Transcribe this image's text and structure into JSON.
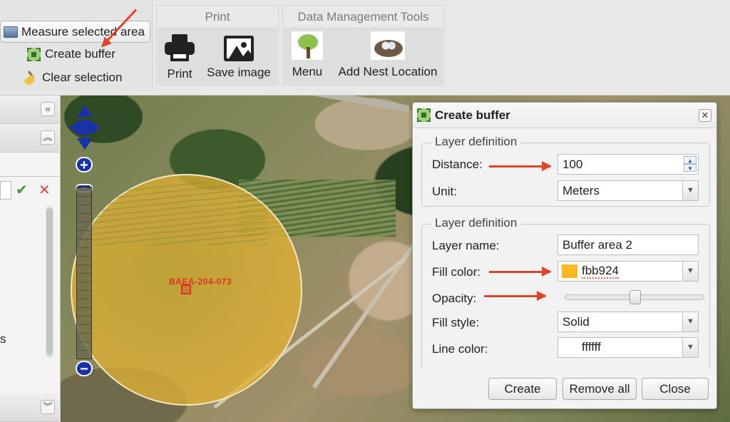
{
  "toolbar": {
    "measure_label": "Measure selected area",
    "create_buffer_label": "Create buffer",
    "clear_selection_label": "Clear selection",
    "print_group": {
      "title": "Print",
      "print_label": "Print",
      "save_image_label": "Save image"
    },
    "data_group": {
      "title": "Data Management Tools",
      "menu_label": "Menu",
      "add_nest_label": "Add Nest Location"
    }
  },
  "left_panel": {
    "collapse_symbol": "«",
    "expand_up_symbol": "︽",
    "expand_down_symbol": "︾",
    "confirm_symbol": "✔",
    "cancel_symbol": "✕",
    "partial_text": "s"
  },
  "map": {
    "zoom_in_symbol": "+",
    "zoom_out_symbol": "−",
    "feature_label": "BAEA-204-073",
    "buffer_fill_color": "#fbb924"
  },
  "dialog": {
    "title": "Create buffer",
    "close_symbol": "✕",
    "section1": {
      "legend": "Layer definition",
      "distance_label": "Distance:",
      "distance_value": "100",
      "unit_label": "Unit:",
      "unit_value": "Meters"
    },
    "section2": {
      "legend": "Layer definition",
      "layer_name_label": "Layer name:",
      "layer_name_value": "Buffer area 2",
      "fill_color_label": "Fill color:",
      "fill_color_value": "fbb924",
      "fill_color_hex": "#fbb924",
      "opacity_label": "Opacity:",
      "opacity_level": 0.5,
      "fill_style_label": "Fill style:",
      "fill_style_value": "Solid",
      "line_color_label": "Line color:",
      "line_color_value": "ffffff",
      "line_color_hex": "#ffffff"
    },
    "buttons": {
      "create": "Create",
      "remove_all": "Remove all",
      "close": "Close"
    }
  },
  "annotations": {
    "arrow_color": "#e0432b"
  }
}
